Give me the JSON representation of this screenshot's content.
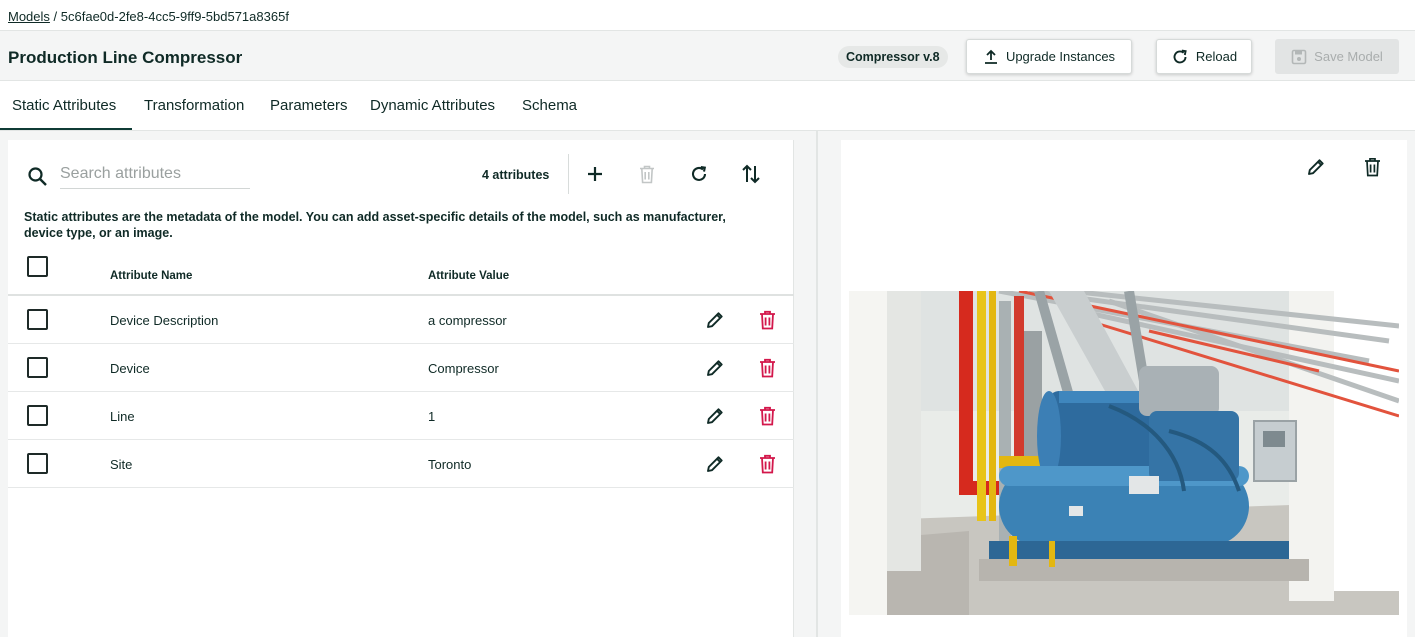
{
  "breadcrumb": {
    "root": "Models",
    "separator": " / ",
    "current": "5c6fae0d-2fe8-4cc5-9ff9-5bd571a8365f"
  },
  "header": {
    "title": "Production Line Compressor",
    "version_chip": "Compressor v.8",
    "upgrade_label": "Upgrade Instances",
    "reload_label": "Reload",
    "save_label": "Save Model",
    "save_disabled": true
  },
  "tabs": [
    {
      "label": "Static Attributes",
      "active": true
    },
    {
      "label": "Transformation",
      "active": false
    },
    {
      "label": "Parameters",
      "active": false
    },
    {
      "label": "Dynamic Attributes",
      "active": false
    },
    {
      "label": "Schema",
      "active": false
    }
  ],
  "attributes_panel": {
    "search_placeholder": "Search attributes",
    "search_value": "",
    "count_label": "4 attributes",
    "toolbar_icons": [
      "search-icon",
      "add-icon",
      "delete-icon",
      "refresh-icon",
      "sort-icon"
    ],
    "description": "Static attributes are the metadata of the model. You can add asset-specific details of the model, such as manufacturer, device type, or an image.",
    "columns": {
      "name": "Attribute Name",
      "value": "Attribute Value"
    },
    "rows": [
      {
        "name": "Device Description",
        "value": "a compressor"
      },
      {
        "name": "Device",
        "value": "Compressor"
      },
      {
        "name": "Line",
        "value": "1"
      },
      {
        "name": "Site",
        "value": "Toronto"
      }
    ]
  },
  "image_panel": {
    "icons": [
      "edit-icon",
      "delete-icon"
    ],
    "image_subject": "industrial compressor"
  },
  "colors": {
    "text": "#0f2a26",
    "delete_accent": "#d3174b",
    "disabled_button": "#e2e4e4",
    "active_tab_underline": "#0f3b35"
  }
}
